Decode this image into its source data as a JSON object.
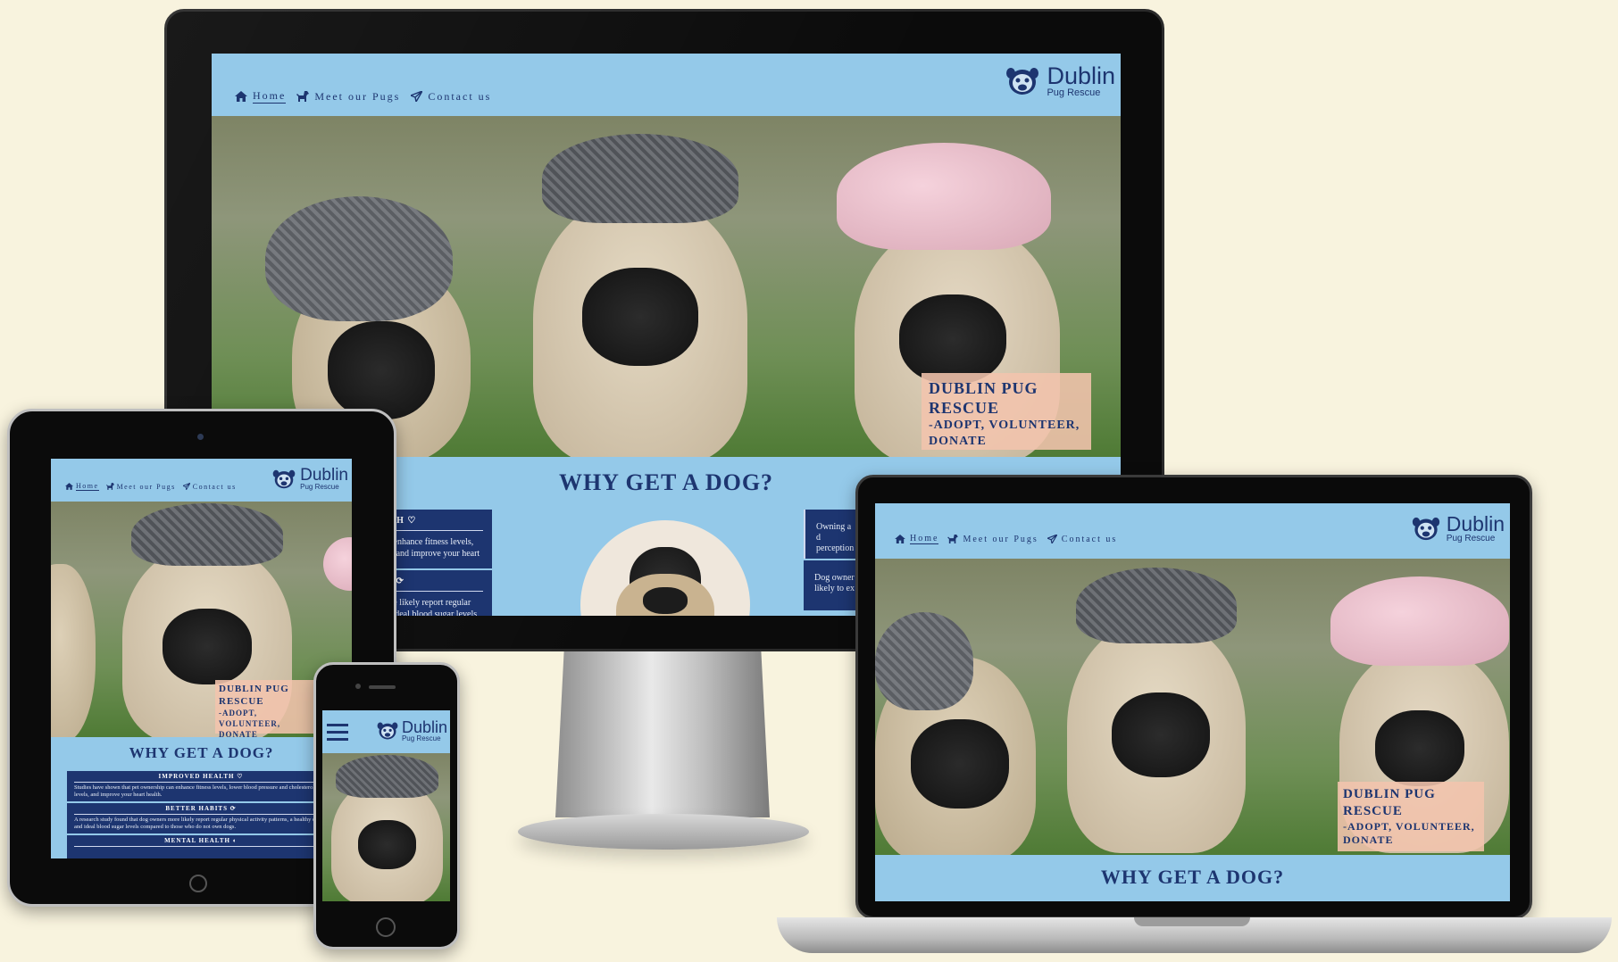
{
  "site": {
    "nav": {
      "home": "Home",
      "pugs": "Meet our Pugs",
      "contact": "Contact us"
    },
    "logo": {
      "title": "Dublin",
      "subtitle": "Pug Rescue"
    },
    "hero_badge": {
      "line1": "DUBLIN PUG RESCUE",
      "line2": "-ADOPT, VOLUNTEER, DONATE"
    },
    "section_heading": "WHY GET A DOG?",
    "cards": [
      {
        "title": "IMPROVED HEALTH",
        "icon": "heart-pulse-icon",
        "text": "Studies have shown that pet ownership can enhance fitness levels, lower blood pressure and cholesterol levels, and improve your heart health."
      },
      {
        "title": "BETTER HABITS",
        "icon": "repeat-icon",
        "text": "A research study found that dog owners more likely report regular physical activity patterns, a healthy diet and ideal blood sugar levels compared to those who do not own dogs."
      },
      {
        "title": "MENTAL HEALTH",
        "icon": "brain-icon",
        "text": ""
      }
    ],
    "desktop_card_fragments": {
      "left1": "ship can enhance fitness levels,",
      "left2": "ol levels, and improve your heart",
      "left3": "ners more likely report regular",
      "left4": "diet and ideal blood sugar levels",
      "right1a": "Owning a d",
      "right1b": "perception",
      "right2a": "Dog owner",
      "right2b": "likely to ex"
    },
    "colors": {
      "header_bg": "#94c9e9",
      "navy": "#1d3570",
      "badge_bg": "#f3c4ad",
      "page_bg": "#f8f3de"
    }
  }
}
